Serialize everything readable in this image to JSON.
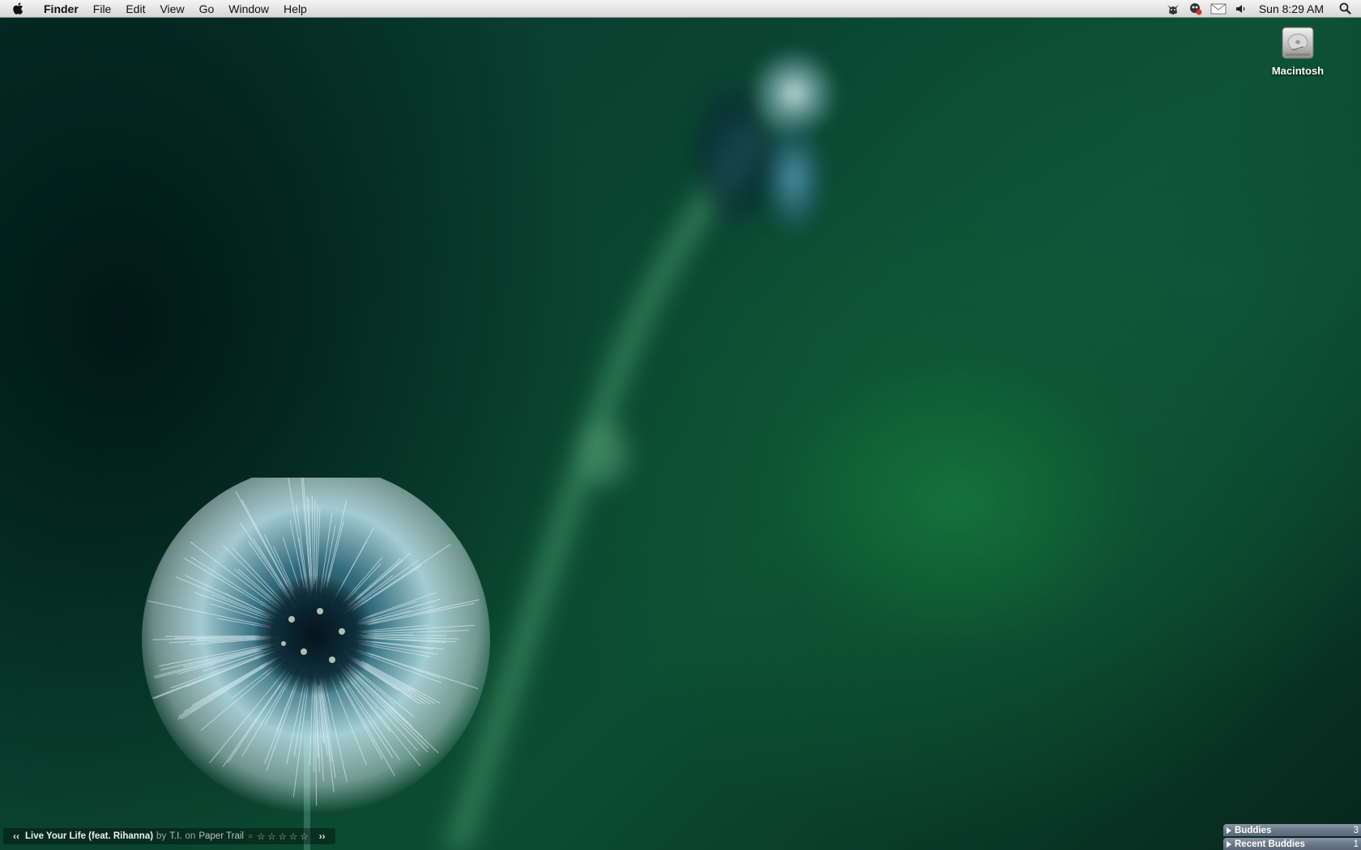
{
  "menubar": {
    "apple_icon": "apple-logo-icon",
    "app_name": "Finder",
    "menus": [
      "File",
      "Edit",
      "View",
      "Go",
      "Window",
      "Help"
    ],
    "status_icons": [
      "growl-cat-icon",
      "adium-duck-icon",
      "mail-icon",
      "volume-icon"
    ],
    "clock": "Sun 8:29 AM",
    "spotlight_icon": "spotlight-search-icon"
  },
  "desktop": {
    "icons": [
      {
        "label": "Macintosh",
        "icon": "hard-drive-icon"
      }
    ]
  },
  "now_playing": {
    "prev_symbol": "‹‹",
    "track": "Live Your Life (feat. Rihanna)",
    "by_word": "by",
    "artist": "T.I.",
    "on_word": "on",
    "album": "Paper Trail",
    "dot": "○",
    "rating_stars": "☆☆☆☆☆",
    "next_symbol": "››"
  },
  "buddy_list": {
    "groups": [
      {
        "label": "Buddies",
        "count": "3"
      },
      {
        "label": "Recent Buddies",
        "count": "1"
      }
    ]
  },
  "colors": {
    "menubar_top": "#f4f4f4",
    "menubar_bottom": "#d6d6d6",
    "wallpaper_green": "#0c4d33",
    "buddy_header": "#6c7889"
  }
}
